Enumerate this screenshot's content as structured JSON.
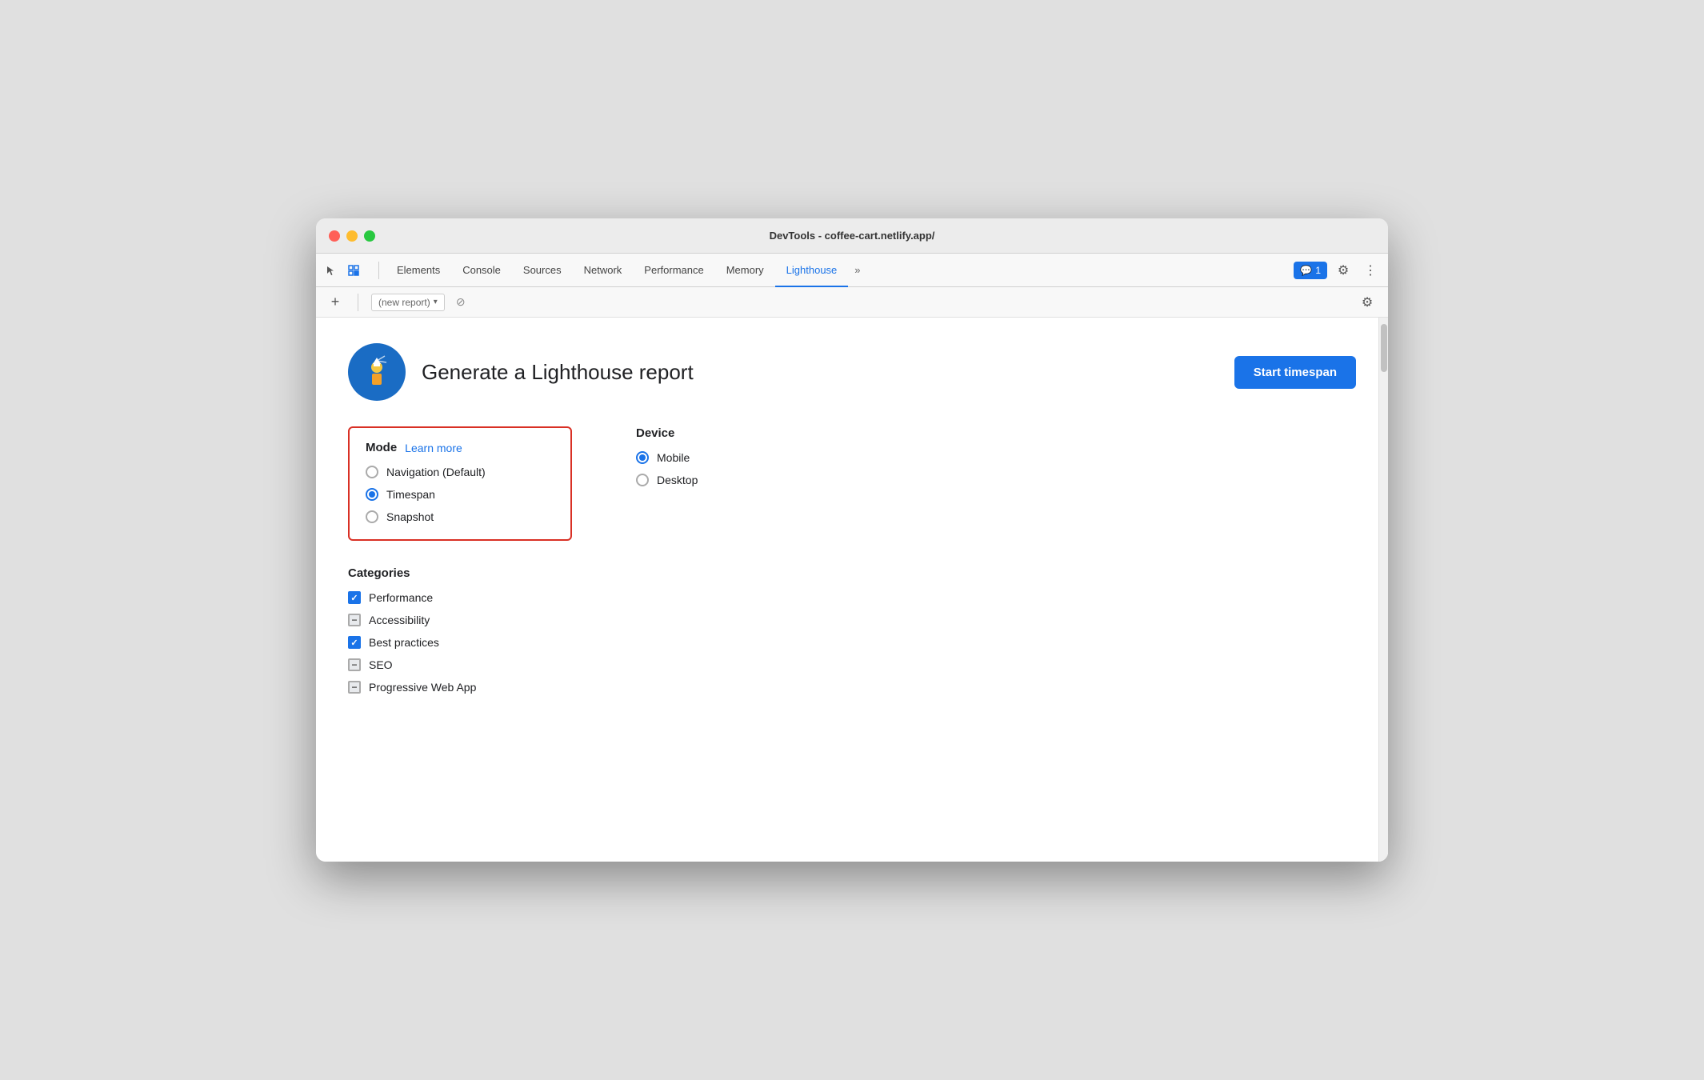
{
  "window": {
    "title": "DevTools - coffee-cart.netlify.app/"
  },
  "tabs": [
    {
      "id": "elements",
      "label": "Elements",
      "active": false
    },
    {
      "id": "console",
      "label": "Console",
      "active": false
    },
    {
      "id": "sources",
      "label": "Sources",
      "active": false
    },
    {
      "id": "network",
      "label": "Network",
      "active": false
    },
    {
      "id": "performance",
      "label": "Performance",
      "active": false
    },
    {
      "id": "memory",
      "label": "Memory",
      "active": false
    },
    {
      "id": "lighthouse",
      "label": "Lighthouse",
      "active": true
    }
  ],
  "tab_more_label": "»",
  "badge": {
    "icon": "💬",
    "count": "1"
  },
  "secondary_toolbar": {
    "add_label": "+",
    "report_placeholder": "(new report)",
    "cancel_icon": "⊘"
  },
  "header": {
    "title": "Generate a Lighthouse report",
    "start_button": "Start timespan"
  },
  "mode_section": {
    "title": "Mode",
    "learn_more": "Learn more",
    "options": [
      {
        "id": "navigation",
        "label": "Navigation (Default)",
        "checked": false
      },
      {
        "id": "timespan",
        "label": "Timespan",
        "checked": true
      },
      {
        "id": "snapshot",
        "label": "Snapshot",
        "checked": false
      }
    ]
  },
  "device_section": {
    "title": "Device",
    "options": [
      {
        "id": "mobile",
        "label": "Mobile",
        "checked": true
      },
      {
        "id": "desktop",
        "label": "Desktop",
        "checked": false
      }
    ]
  },
  "categories_section": {
    "title": "Categories",
    "items": [
      {
        "id": "performance",
        "label": "Performance",
        "state": "checked"
      },
      {
        "id": "accessibility",
        "label": "Accessibility",
        "state": "indeterminate"
      },
      {
        "id": "best-practices",
        "label": "Best practices",
        "state": "checked"
      },
      {
        "id": "seo",
        "label": "SEO",
        "state": "indeterminate"
      },
      {
        "id": "pwa",
        "label": "Progressive Web App",
        "state": "indeterminate"
      }
    ]
  },
  "colors": {
    "active_tab": "#1a73e8",
    "start_button": "#1a73e8",
    "mode_border": "#d93025",
    "link": "#1a73e8"
  }
}
